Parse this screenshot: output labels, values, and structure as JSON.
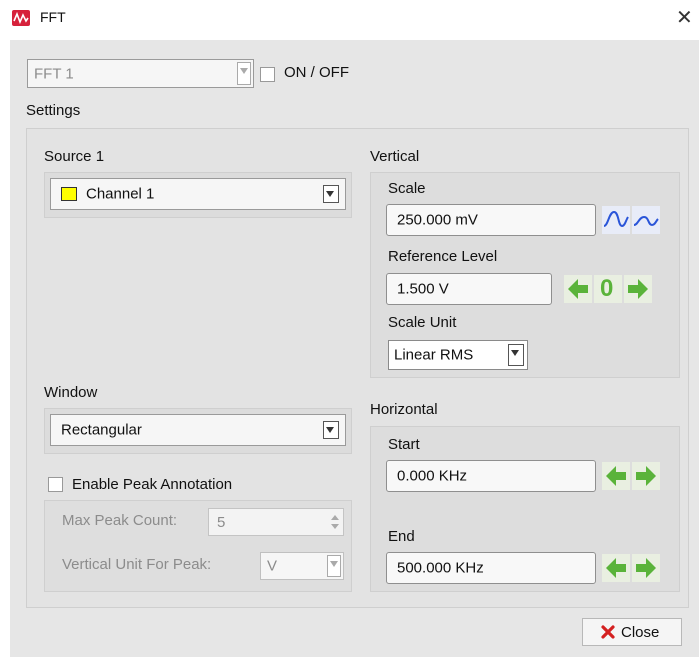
{
  "window": {
    "title": "FFT",
    "close_glyph": "✕"
  },
  "fft_select": {
    "value": "FFT 1",
    "enabled": false
  },
  "onoff": {
    "label": "ON / OFF",
    "checked": false
  },
  "settings_label": "Settings",
  "source": {
    "label": "Source 1",
    "value": "Channel 1",
    "channel_color": "#ffff00"
  },
  "window_fn": {
    "label": "Window",
    "value": "Rectangular"
  },
  "peak": {
    "enable_label": "Enable Peak Annotation",
    "enabled": false,
    "max_count_label": "Max Peak Count:",
    "max_count_value": "5",
    "vertical_unit_label": "Vertical Unit For Peak:",
    "vertical_unit_value": "V"
  },
  "vertical": {
    "label": "Vertical",
    "scale_label": "Scale",
    "scale_value": "250.000 mV",
    "ref_label": "Reference Level",
    "ref_value": "1.500 V",
    "zero_glyph": "0",
    "unit_label": "Scale Unit",
    "unit_value": "Linear RMS"
  },
  "horizontal": {
    "label": "Horizontal",
    "start_label": "Start",
    "start_value": "0.000 KHz",
    "end_label": "End",
    "end_value": "500.000 KHz"
  },
  "close_button": {
    "label": "Close"
  },
  "colors": {
    "arrow_green": "#5ab33a",
    "wave_blue": "#2a55d8",
    "close_red": "#d42020"
  }
}
